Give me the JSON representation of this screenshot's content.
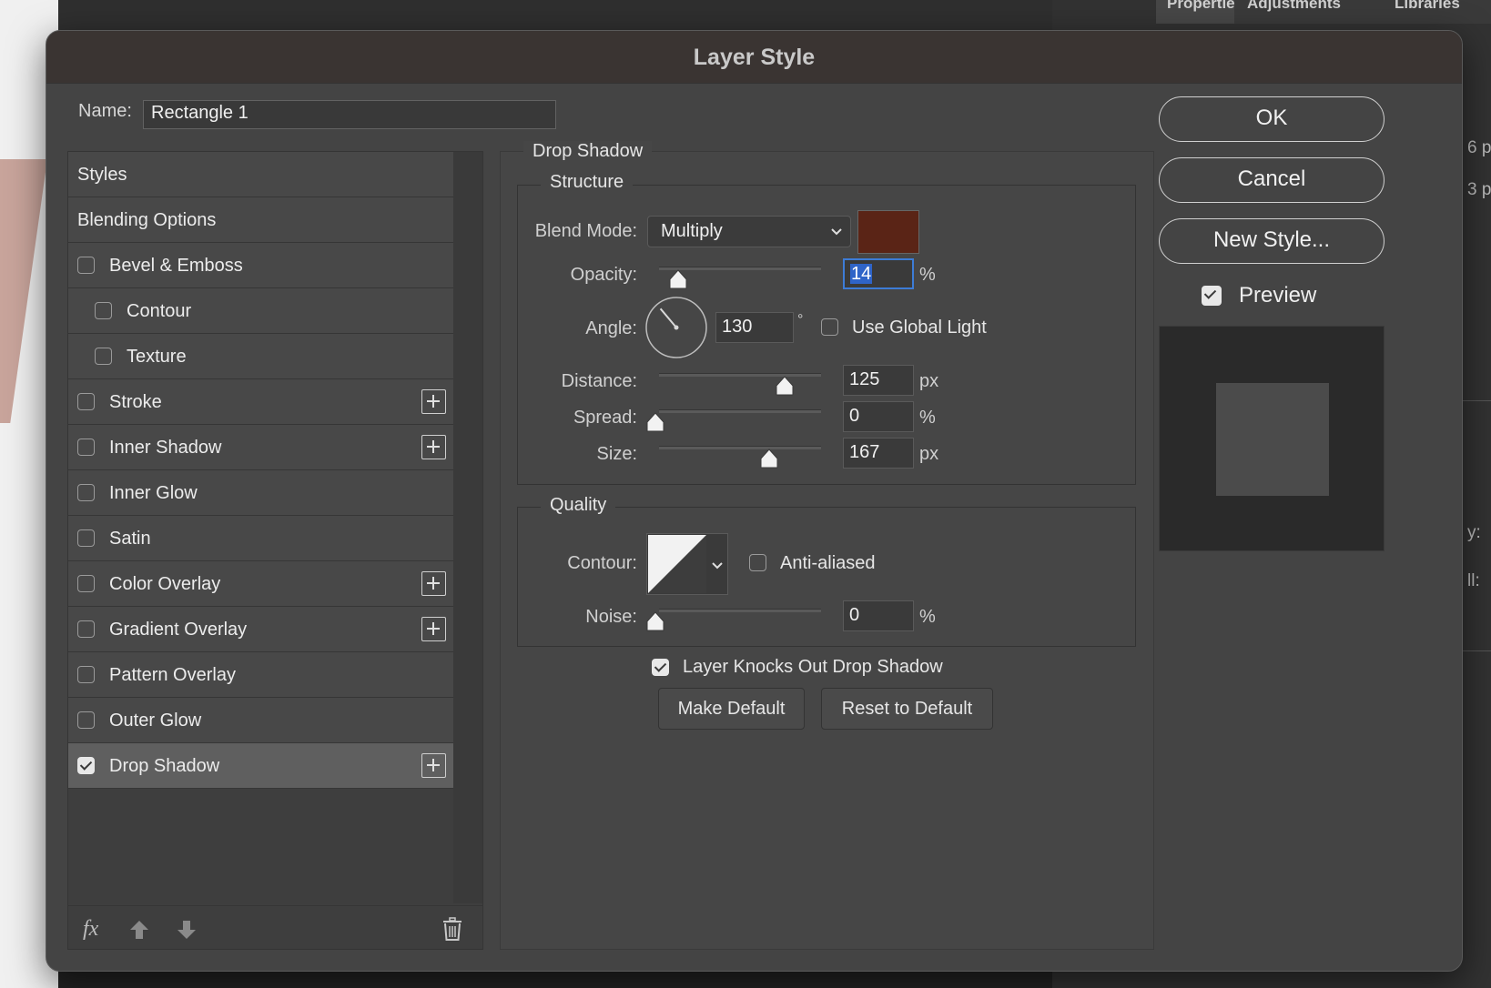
{
  "background": {
    "tabs": [
      "Properties",
      "Adjustments",
      "Libraries"
    ],
    "fragments": [
      "6 p",
      "3 p",
      "y:",
      "ll:"
    ]
  },
  "dialog": {
    "title": "Layer Style",
    "name_label": "Name:",
    "name_value": "Rectangle 1"
  },
  "style_list": {
    "items": [
      {
        "label": "Styles",
        "checkbox": false,
        "checked": false,
        "plus": false,
        "indent": false
      },
      {
        "label": "Blending Options",
        "checkbox": false,
        "checked": false,
        "plus": false,
        "indent": false
      },
      {
        "label": "Bevel & Emboss",
        "checkbox": true,
        "checked": false,
        "plus": false,
        "indent": false
      },
      {
        "label": "Contour",
        "checkbox": true,
        "checked": false,
        "plus": false,
        "indent": true
      },
      {
        "label": "Texture",
        "checkbox": true,
        "checked": false,
        "plus": false,
        "indent": true
      },
      {
        "label": "Stroke",
        "checkbox": true,
        "checked": false,
        "plus": true,
        "indent": false
      },
      {
        "label": "Inner Shadow",
        "checkbox": true,
        "checked": false,
        "plus": true,
        "indent": false
      },
      {
        "label": "Inner Glow",
        "checkbox": true,
        "checked": false,
        "plus": false,
        "indent": false
      },
      {
        "label": "Satin",
        "checkbox": true,
        "checked": false,
        "plus": false,
        "indent": false
      },
      {
        "label": "Color Overlay",
        "checkbox": true,
        "checked": false,
        "plus": true,
        "indent": false
      },
      {
        "label": "Gradient Overlay",
        "checkbox": true,
        "checked": false,
        "plus": true,
        "indent": false
      },
      {
        "label": "Pattern Overlay",
        "checkbox": true,
        "checked": false,
        "plus": false,
        "indent": false
      },
      {
        "label": "Outer Glow",
        "checkbox": true,
        "checked": false,
        "plus": false,
        "indent": false
      },
      {
        "label": "Drop Shadow",
        "checkbox": true,
        "checked": true,
        "plus": true,
        "indent": false,
        "selected": true
      }
    ],
    "footer": {
      "fx_label": "fx"
    }
  },
  "drop_shadow": {
    "section_title": "Drop Shadow",
    "structure": {
      "title": "Structure",
      "blend_mode_label": "Blend Mode:",
      "blend_mode_value": "Multiply",
      "shadow_color": "#5a2416",
      "opacity_label": "Opacity:",
      "opacity_value": "14",
      "opacity_unit": "%",
      "opacity_fraction": 0.14,
      "angle_label": "Angle:",
      "angle_value": "130",
      "angle_unit": "°",
      "angle_degrees": 130,
      "use_global_light_label": "Use Global Light",
      "use_global_light_checked": false,
      "distance_label": "Distance:",
      "distance_value": "125",
      "distance_unit": "px",
      "distance_fraction": 0.8,
      "spread_label": "Spread:",
      "spread_value": "0",
      "spread_unit": "%",
      "spread_fraction": 0.0,
      "size_label": "Size:",
      "size_value": "167",
      "size_unit": "px",
      "size_fraction": 0.7
    },
    "quality": {
      "title": "Quality",
      "contour_label": "Contour:",
      "anti_aliased_label": "Anti-aliased",
      "anti_aliased_checked": false,
      "noise_label": "Noise:",
      "noise_value": "0",
      "noise_unit": "%",
      "noise_fraction": 0.0
    },
    "knockout_label": "Layer Knocks Out Drop Shadow",
    "knockout_checked": true,
    "make_default_label": "Make Default",
    "reset_default_label": "Reset to Default"
  },
  "actions": {
    "ok_label": "OK",
    "cancel_label": "Cancel",
    "new_style_label": "New Style...",
    "preview_label": "Preview",
    "preview_checked": true
  }
}
